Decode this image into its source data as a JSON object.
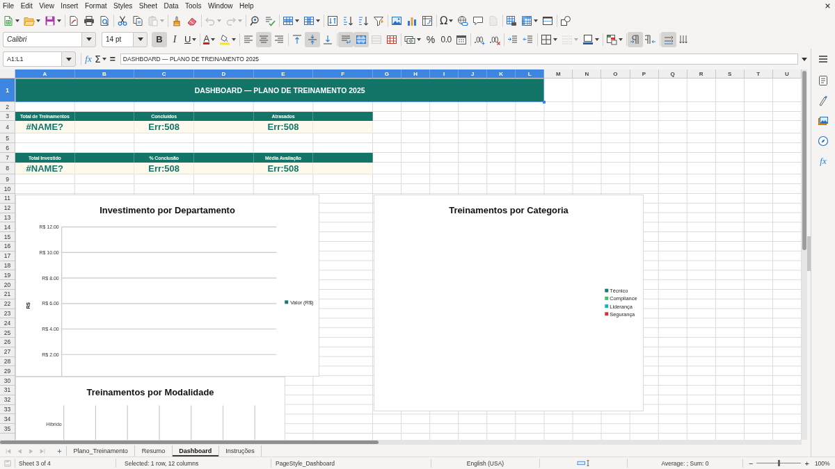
{
  "menu": [
    "File",
    "Edit",
    "View",
    "Insert",
    "Format",
    "Styles",
    "Sheet",
    "Data",
    "Tools",
    "Window",
    "Help"
  ],
  "standard_toolbar": [
    [
      {
        "kind": "new",
        "dropdown": true,
        "disabled": false
      },
      {
        "kind": "open",
        "dropdown": true,
        "disabled": false
      },
      {
        "kind": "save",
        "dropdown": true,
        "disabled": false
      }
    ],
    [
      {
        "kind": "export-pdf",
        "dropdown": false,
        "disabled": false
      },
      {
        "kind": "print",
        "dropdown": false,
        "disabled": false
      },
      {
        "kind": "print-preview",
        "dropdown": false,
        "disabled": false
      }
    ],
    [
      {
        "kind": "cut",
        "dropdown": false,
        "disabled": false
      },
      {
        "kind": "copy",
        "dropdown": false,
        "disabled": false
      },
      {
        "kind": "paste",
        "dropdown": true,
        "disabled": true
      }
    ],
    [
      {
        "kind": "clone-formatting",
        "dropdown": false,
        "disabled": false
      },
      {
        "kind": "clear-formatting",
        "dropdown": false,
        "disabled": false
      }
    ],
    [
      {
        "kind": "undo",
        "dropdown": true,
        "disabled": true
      },
      {
        "kind": "redo",
        "dropdown": true,
        "disabled": true
      }
    ],
    [
      {
        "kind": "find-replace",
        "dropdown": false,
        "disabled": false
      },
      {
        "kind": "spelling",
        "dropdown": false,
        "disabled": false
      }
    ],
    [
      {
        "kind": "rows",
        "dropdown": true,
        "disabled": false
      },
      {
        "kind": "columns",
        "dropdown": true,
        "disabled": false
      }
    ],
    [
      {
        "kind": "sort",
        "dropdown": false,
        "disabled": false
      },
      {
        "kind": "sort-ascending",
        "dropdown": false,
        "disabled": false
      },
      {
        "kind": "sort-descending",
        "dropdown": false,
        "disabled": false
      },
      {
        "kind": "autofilter",
        "dropdown": false,
        "disabled": false
      }
    ],
    [
      {
        "kind": "image",
        "dropdown": false,
        "disabled": false
      },
      {
        "kind": "chart",
        "dropdown": false,
        "disabled": false
      },
      {
        "kind": "pivot-table",
        "dropdown": false,
        "disabled": false
      }
    ],
    [
      {
        "kind": "special-character",
        "label": "Ω",
        "dropdown": true,
        "disabled": false
      },
      {
        "kind": "hyperlink",
        "dropdown": false,
        "disabled": false
      },
      {
        "kind": "comment",
        "dropdown": false,
        "disabled": false
      },
      {
        "kind": "header-footer",
        "dropdown": false,
        "disabled": true
      }
    ],
    [
      {
        "kind": "print-area",
        "dropdown": false,
        "disabled": false
      },
      {
        "kind": "freeze",
        "dropdown": true,
        "disabled": false
      },
      {
        "kind": "split-window",
        "dropdown": false,
        "disabled": false
      }
    ],
    [
      {
        "kind": "draw-functions",
        "dropdown": false,
        "disabled": false
      }
    ]
  ],
  "formatting_toolbar": {
    "font_name": "Calibri",
    "font_size": "14 pt",
    "groups": [
      [
        {
          "kind": "bold",
          "label": "B",
          "dropdown": false,
          "disabled": false,
          "on": true
        },
        {
          "kind": "italic",
          "label": "I",
          "dropdown": false,
          "disabled": false,
          "on": false
        },
        {
          "kind": "underline",
          "label": "U",
          "dropdown": true,
          "disabled": false,
          "on": false
        }
      ],
      [
        {
          "kind": "font-color",
          "label": "A",
          "dropdown": true,
          "disabled": false,
          "on": false
        },
        {
          "kind": "highlight",
          "dropdown": true,
          "disabled": false,
          "on": false
        }
      ],
      [
        {
          "kind": "align-left",
          "dropdown": false,
          "disabled": false,
          "on": false
        },
        {
          "kind": "align-center",
          "dropdown": false,
          "disabled": false,
          "on": true
        },
        {
          "kind": "align-right",
          "dropdown": false,
          "disabled": false,
          "on": false
        }
      ],
      [
        {
          "kind": "align-top",
          "dropdown": false,
          "disabled": false,
          "on": false
        },
        {
          "kind": "align-middle",
          "dropdown": false,
          "disabled": false,
          "on": true
        },
        {
          "kind": "align-bottom",
          "dropdown": false,
          "disabled": false,
          "on": false
        }
      ],
      [
        {
          "kind": "wrap-text",
          "dropdown": false,
          "disabled": false,
          "on": true
        },
        {
          "kind": "merge-center",
          "dropdown": false,
          "disabled": false,
          "on": true
        },
        {
          "kind": "merge-cells",
          "dropdown": false,
          "disabled": true,
          "on": false
        },
        {
          "kind": "unmerge-cells",
          "dropdown": false,
          "disabled": false,
          "on": false
        }
      ],
      [
        {
          "kind": "currency",
          "dropdown": true,
          "disabled": false,
          "on": false
        },
        {
          "kind": "percent",
          "label": "%",
          "dropdown": false,
          "disabled": false,
          "on": false
        },
        {
          "kind": "number",
          "label": "0.0",
          "dropdown": false,
          "disabled": false,
          "on": false
        },
        {
          "kind": "date",
          "dropdown": false,
          "disabled": false,
          "on": false
        }
      ],
      [
        {
          "kind": "add-decimal",
          "dropdown": false,
          "disabled": false,
          "on": false
        },
        {
          "kind": "delete-decimal",
          "dropdown": false,
          "disabled": false,
          "on": false
        }
      ],
      [
        {
          "kind": "indent-increase",
          "dropdown": false,
          "disabled": false,
          "on": false
        },
        {
          "kind": "indent-decrease",
          "dropdown": false,
          "disabled": false,
          "on": false
        }
      ],
      [
        {
          "kind": "borders",
          "dropdown": true,
          "disabled": false,
          "on": false
        },
        {
          "kind": "border-style",
          "dropdown": true,
          "disabled": true,
          "on": false
        },
        {
          "kind": "border-color",
          "dropdown": true,
          "disabled": false,
          "on": false
        }
      ],
      [
        {
          "kind": "conditional",
          "dropdown": true,
          "disabled": false,
          "on": false
        }
      ],
      [
        {
          "kind": "left-to-right",
          "dropdown": false,
          "disabled": false,
          "on": true
        },
        {
          "kind": "right-to-left",
          "dropdown": false,
          "disabled": false,
          "on": false
        }
      ],
      [
        {
          "kind": "text-horizontal",
          "dropdown": false,
          "disabled": false,
          "on": true
        },
        {
          "kind": "text-vertical",
          "dropdown": false,
          "disabled": false,
          "on": false
        }
      ]
    ]
  },
  "formula_bar": {
    "name_box": "A1:L1",
    "buttons": [
      {
        "kind": "function-wizard",
        "label": "fx",
        "dropdown": false
      },
      {
        "kind": "sum",
        "label": "Σ",
        "dropdown": true
      },
      {
        "kind": "formula",
        "label": "=",
        "dropdown": false
      }
    ],
    "content": "DASHBOARD — PLANO DE TREINAMENTO 2025"
  },
  "sidebar": [
    {
      "kind": "menu"
    },
    {
      "kind": "properties"
    },
    {
      "kind": "styles"
    },
    {
      "kind": "gallery"
    },
    {
      "kind": "navigator"
    },
    {
      "kind": "functions",
      "label": "fx"
    }
  ],
  "sheet": {
    "columns": [
      {
        "label": "A",
        "selected": true
      },
      {
        "label": "B",
        "selected": true
      },
      {
        "label": "C",
        "selected": true
      },
      {
        "label": "D",
        "selected": true
      },
      {
        "label": "E",
        "selected": true
      },
      {
        "label": "F",
        "selected": true
      },
      {
        "label": "G",
        "selected": true
      },
      {
        "label": "H",
        "selected": true
      },
      {
        "label": "I",
        "selected": true
      },
      {
        "label": "J",
        "selected": true
      },
      {
        "label": "K",
        "selected": true
      },
      {
        "label": "L",
        "selected": true
      },
      {
        "label": "M",
        "selected": false
      },
      {
        "label": "N",
        "selected": false
      },
      {
        "label": "O",
        "selected": false
      },
      {
        "label": "P",
        "selected": false
      },
      {
        "label": "Q",
        "selected": false
      },
      {
        "label": "R",
        "selected": false
      },
      {
        "label": "S",
        "selected": false
      },
      {
        "label": "T",
        "selected": false
      },
      {
        "label": "U",
        "selected": false
      }
    ],
    "rows": [
      {
        "label": "1",
        "selected": true
      },
      {
        "label": "2",
        "selected": false
      },
      {
        "label": "3",
        "selected": false
      },
      {
        "label": "4",
        "selected": false
      },
      {
        "label": "5",
        "selected": false
      },
      {
        "label": "6",
        "selected": false
      },
      {
        "label": "7",
        "selected": false
      },
      {
        "label": "8",
        "selected": false
      },
      {
        "label": "9",
        "selected": false
      },
      {
        "label": "10",
        "selected": false
      },
      {
        "label": "11",
        "selected": false
      },
      {
        "label": "12",
        "selected": false
      },
      {
        "label": "13",
        "selected": false
      },
      {
        "label": "14",
        "selected": false
      },
      {
        "label": "15",
        "selected": false
      },
      {
        "label": "16",
        "selected": false
      },
      {
        "label": "17",
        "selected": false
      },
      {
        "label": "18",
        "selected": false
      },
      {
        "label": "19",
        "selected": false
      },
      {
        "label": "20",
        "selected": false
      },
      {
        "label": "21",
        "selected": false
      },
      {
        "label": "22",
        "selected": false
      },
      {
        "label": "23",
        "selected": false
      },
      {
        "label": "24",
        "selected": false
      },
      {
        "label": "25",
        "selected": false
      },
      {
        "label": "26",
        "selected": false
      },
      {
        "label": "27",
        "selected": false
      },
      {
        "label": "28",
        "selected": false
      },
      {
        "label": "29",
        "selected": false
      },
      {
        "label": "30",
        "selected": false
      },
      {
        "label": "31",
        "selected": false
      },
      {
        "label": "32",
        "selected": false
      },
      {
        "label": "33",
        "selected": false
      },
      {
        "label": "34",
        "selected": false
      },
      {
        "label": "35",
        "selected": false
      }
    ],
    "title": {
      "text": "DASHBOARD — PLANO DE TREINAMENTO 2025",
      "selected": true
    },
    "kpi_groups": [
      {
        "items": [
          {
            "label": "Total de Treinamentos",
            "value": "#NAME?"
          },
          {
            "label": "Concluídos",
            "value": "Err:508"
          },
          {
            "label": "Atrasados",
            "value": "Err:508"
          }
        ]
      },
      {
        "items": [
          {
            "label": "Total Investido",
            "value": "#NAME?"
          },
          {
            "label": "% Conclusão",
            "value": "Err:508"
          },
          {
            "label": "Média Avaliação",
            "value": "Err:508"
          }
        ]
      }
    ],
    "charts": [
      {
        "kind": "column",
        "title": "Investimento por Departamento",
        "y_axis_title": "R$",
        "y_axis_labels": [
          "R$ 12.00",
          "R$ 10.00",
          "R$ 8.00",
          "R$ 6.00",
          "R$ 4.00",
          "R$ 2.00"
        ],
        "legend": [
          {
            "label": "Valor (R$)",
            "color": "#1b7a6e"
          }
        ]
      },
      {
        "kind": "pie",
        "title": "Treinamentos por Categoria",
        "legend": [
          {
            "label": "Técnico",
            "color": "#1b7a6e"
          },
          {
            "label": "Compliance",
            "color": "#3cc46a"
          },
          {
            "label": "Liderança",
            "color": "#22b3a6"
          },
          {
            "label": "Segurança",
            "color": "#d9312d"
          }
        ]
      },
      {
        "kind": "bar",
        "title": "Treinamentos por Modalidade",
        "category_labels": [
          "Híbrido"
        ]
      }
    ]
  },
  "sheet_navigation": [
    {
      "kind": "first",
      "disabled": true
    },
    {
      "kind": "previous",
      "disabled": true
    },
    {
      "kind": "next",
      "disabled": true
    },
    {
      "kind": "last",
      "disabled": true
    }
  ],
  "sheet_tabs": [
    {
      "label": "Plano_Treinamento",
      "selected": false
    },
    {
      "label": "Resumo",
      "selected": false
    },
    {
      "label": "Dashboard",
      "selected": true
    },
    {
      "label": "Instruções",
      "selected": false
    }
  ],
  "status_bar": {
    "sheet": "Sheet 3 of 4",
    "selection": "Selected: 1 row, 12 columns",
    "page_style": "PageStyle_Dashboard",
    "language": "English (USA)",
    "summary": "Average: ; Sum: 0",
    "zoom": {
      "minus": "−",
      "plus": "+",
      "level": 0.5,
      "value": "100%"
    }
  }
}
